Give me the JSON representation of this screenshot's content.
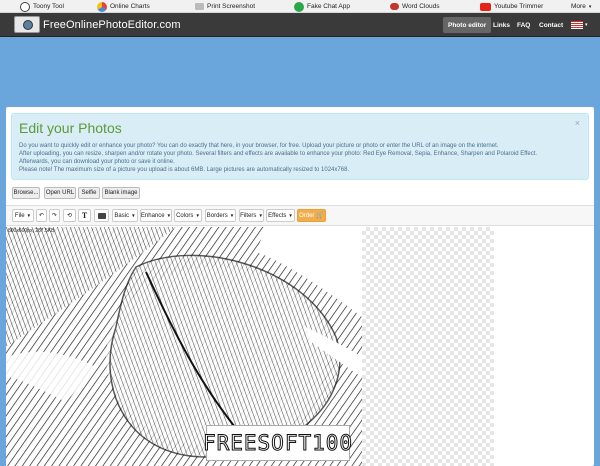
{
  "topbar": {
    "items": [
      {
        "label": "Toony Tool",
        "icon": "toony-tool-icon",
        "color": "#444"
      },
      {
        "label": "Online Charts",
        "icon": "charts-icon",
        "color": "#e8413b"
      },
      {
        "label": "Print Screenshot",
        "icon": "print-icon",
        "color": "#888"
      },
      {
        "label": "Fake Chat App",
        "icon": "chat-icon",
        "color": "#2ba84a"
      },
      {
        "label": "Word Clouds",
        "icon": "cloud-icon",
        "color": "#c0392b"
      },
      {
        "label": "Youtube Trimmer",
        "icon": "youtube-icon",
        "color": "#e62117"
      }
    ],
    "more": "More"
  },
  "navbar": {
    "brand": "FreeOnlinePhotoEditor.com",
    "links": [
      "Photo editor",
      "Links",
      "FAQ",
      "Contact"
    ],
    "flag_icon": "us-flag-icon"
  },
  "alert": {
    "title": "Edit your Photos",
    "close": "×",
    "lines": [
      "Do you want to quickly edit or enhance your photo? You can do exactly that here, in your browser, for free. Upload your picture or photo or enter the URL of an image on the internet.",
      "After uploading, you can resize, sharpen and/or rotate your photo. Several filters and effects are available to enhance your photo: Red Eye Removal, Sepia, Enhance, Sharpen and Polaroid Effect.",
      "Afterwards, you can download your photo or save it online.",
      "Please note! The maximum size of a picture you upload is about 6MB. Large pictures are automatically resized to 1024x768."
    ]
  },
  "upload": {
    "browse": "Browse...",
    "open_url": "Open URL",
    "selfie": "Selfie",
    "blank": "Blank image"
  },
  "toolbar": {
    "file": "File",
    "basic": "Basic",
    "enhance": "Enhance",
    "colors": "Colors",
    "borders": "Borders",
    "filters": "Filters",
    "effects": "Effects",
    "order": "Order"
  },
  "image": {
    "size_info": "800x600px, 287.5KB",
    "watermark": "FREESOFT100"
  },
  "colors": {
    "accent": "#f0ad4e",
    "info_bg": "#d9edf7",
    "title": "#5d9a39",
    "page_bg": "#6aa6dc"
  }
}
